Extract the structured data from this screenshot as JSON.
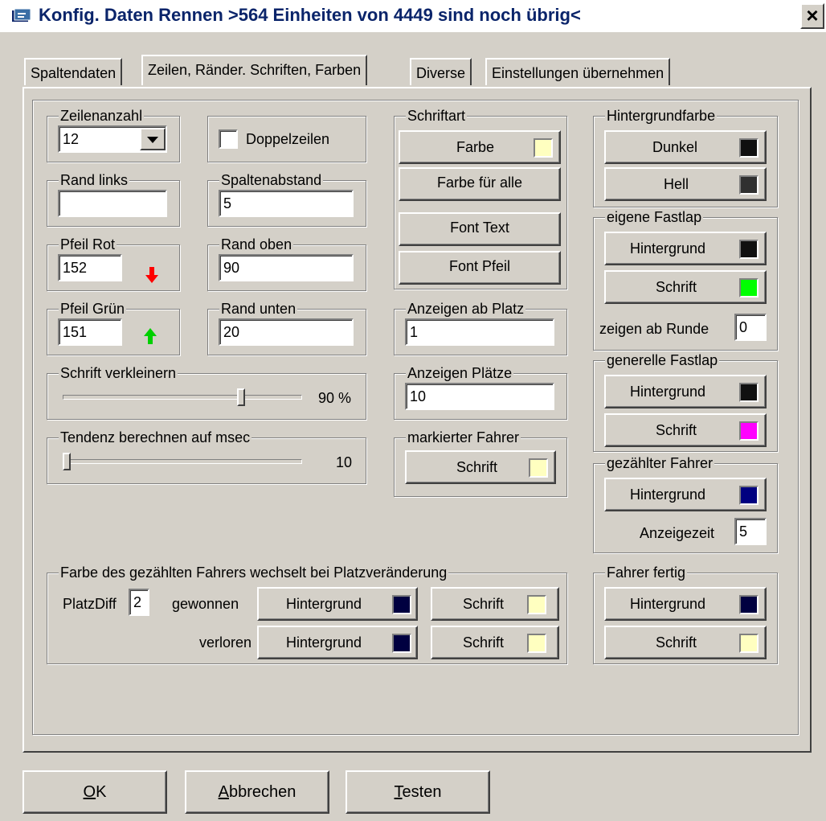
{
  "window": {
    "title": "Konfig. Daten Rennen >564 Einheiten von 4449 sind noch übrig<",
    "close_label": "×"
  },
  "tabs": [
    {
      "label": "Spaltendaten"
    },
    {
      "label": "Zeilen, Ränder. Schriften, Farben"
    },
    {
      "label": "Diverse"
    },
    {
      "label": "Einstellungen übernehmen"
    }
  ],
  "zeilenanzahl": {
    "label": "Zeilenanzahl",
    "value": "12"
  },
  "doppelzeilen": {
    "label": "Doppelzeilen",
    "checked": false
  },
  "rand_links": {
    "label": "Rand links",
    "value": ""
  },
  "spaltenabstand": {
    "label": "Spaltenabstand",
    "value": "5"
  },
  "pfeil_rot": {
    "label": "Pfeil Rot",
    "value": "152",
    "color": "#ff0000"
  },
  "rand_oben": {
    "label": "Rand oben",
    "value": "90"
  },
  "pfeil_gruen": {
    "label": "Pfeil Grün",
    "value": "151",
    "color": "#00c000"
  },
  "rand_unten": {
    "label": "Rand unten",
    "value": "20"
  },
  "schrift_verkleinern": {
    "label": "Schrift verkleinern",
    "value_text": "90 %",
    "value": 90
  },
  "tendenz": {
    "label": "Tendenz berechnen auf msec",
    "value_text": "10",
    "value": 10
  },
  "schriftart": {
    "label": "Schriftart",
    "farbe": "Farbe",
    "farbe_color": "#ffffc0",
    "farbe_fuer_alle": "Farbe für alle",
    "font_text": "Font Text",
    "font_pfeil": "Font Pfeil"
  },
  "anzeigen_ab_platz": {
    "label": "Anzeigen ab Platz",
    "value": "1"
  },
  "anzeigen_plaetze": {
    "label": "Anzeigen Plätze",
    "value": "10"
  },
  "markierter_fahrer": {
    "label": "markierter Fahrer",
    "schrift": "Schrift",
    "color": "#ffffc0"
  },
  "hintergrundfarbe": {
    "label": "Hintergrundfarbe",
    "dunkel": "Dunkel",
    "dunkel_color": "#101010",
    "hell": "Hell",
    "hell_color": "#303030"
  },
  "eigene_fastlap": {
    "label": "eigene Fastlap",
    "hintergrund": "Hintergrund",
    "hintergrund_color": "#101010",
    "schrift": "Schrift",
    "schrift_color": "#00ff00",
    "zeigen_ab_runde_label": "zeigen ab Runde",
    "zeigen_ab_runde": "0"
  },
  "generelle_fastlap": {
    "label": "generelle Fastlap",
    "hintergrund": "Hintergrund",
    "hintergrund_color": "#101010",
    "schrift": "Schrift",
    "schrift_color": "#ff00ff"
  },
  "gezaehlter_fahrer": {
    "label": "gezählter Fahrer",
    "hintergrund": "Hintergrund",
    "hintergrund_color": "#000080",
    "anzeigezeit_label": "Anzeigezeit",
    "anzeigezeit": "5"
  },
  "fahrer_fertig": {
    "label": "Fahrer fertig",
    "hintergrund": "Hintergrund",
    "hintergrund_color": "#000040",
    "schrift": "Schrift",
    "schrift_color": "#ffffc0"
  },
  "platz_change": {
    "label": "Farbe des gezählten Fahrers wechselt bei Platzveränderung",
    "platzdiff_label": "PlatzDiff",
    "platzdiff": "2",
    "gewonnen": "gewonnen",
    "verloren": "verloren",
    "hintergrund": "Hintergrund",
    "schrift": "Schrift",
    "bg_color": "#000040",
    "schrift_color": "#ffffc0"
  },
  "footer": {
    "ok": {
      "u": "O",
      "rest": "K"
    },
    "abbrechen": {
      "u": "A",
      "rest": "bbrechen"
    },
    "testen": {
      "u": "T",
      "rest": "esten"
    }
  }
}
